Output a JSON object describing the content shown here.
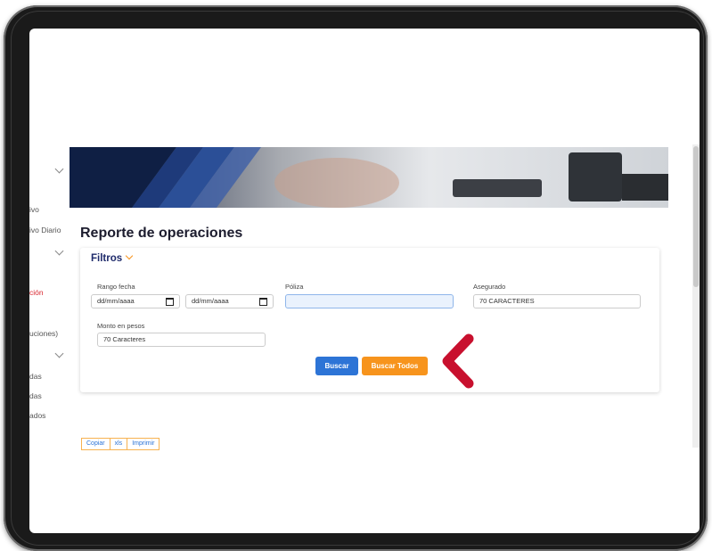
{
  "sidebar": {
    "items": [
      {
        "label": "ivo",
        "color": "#555555"
      },
      {
        "label": "ivo Diario",
        "color": "#555555"
      },
      {
        "label": "ción",
        "color": "#d8262f"
      },
      {
        "label": "uciones)",
        "color": "#555555"
      },
      {
        "label": "das",
        "color": "#555555"
      },
      {
        "label": "das",
        "color": "#555555"
      },
      {
        "label": "ados",
        "color": "#555555"
      }
    ]
  },
  "page": {
    "title": "Reporte de operaciones"
  },
  "filters": {
    "heading": "Filtros",
    "date_range": {
      "label": "Rango fecha",
      "from_value": "dd/mm/aaaa",
      "to_value": "dd/mm/aaaa"
    },
    "policy": {
      "label": "Póliza",
      "value": ""
    },
    "insured": {
      "label": "Asegurado",
      "placeholder": "70  CARACTERES"
    },
    "amount": {
      "label": "Monto en pesos",
      "placeholder": "70  Caracteres"
    }
  },
  "actions": {
    "search_label": "Buscar",
    "search_all_label": "Buscar Todos"
  },
  "export": {
    "buttons": [
      "Copiar",
      "xls",
      "Imprimir"
    ]
  },
  "colors": {
    "primary_blue": "#2d74d6",
    "accent_orange": "#f7941d",
    "pointer_red": "#c8102e",
    "title_navy": "#1f2b6b"
  }
}
